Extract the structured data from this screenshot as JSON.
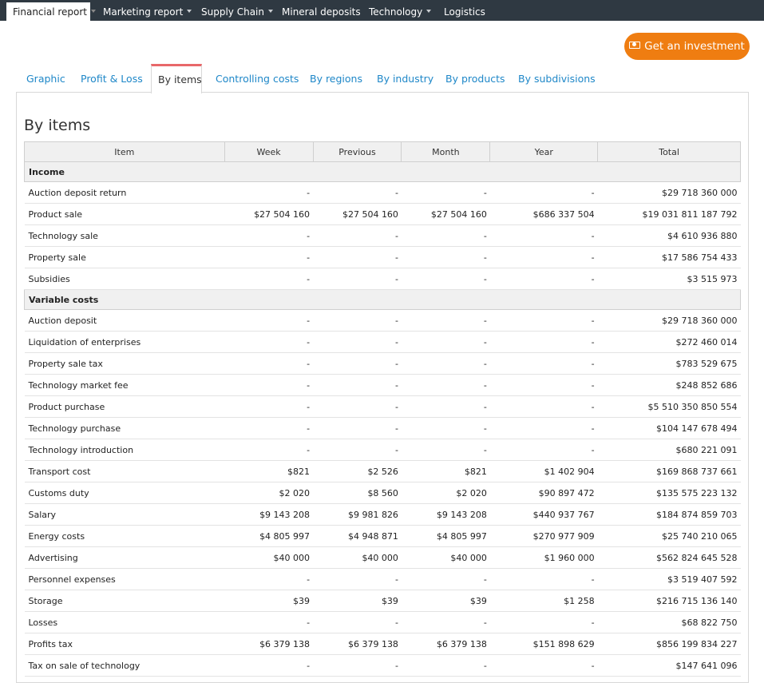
{
  "topnav": {
    "tabs": [
      {
        "label": "Financial report",
        "dropdown": true,
        "active": true
      },
      {
        "label": "Marketing report",
        "dropdown": true,
        "active": false
      },
      {
        "label": "Supply Chain",
        "dropdown": true,
        "active": false
      },
      {
        "label": "Mineral deposits",
        "dropdown": false,
        "active": false
      },
      {
        "label": "Technology",
        "dropdown": true,
        "active": false
      },
      {
        "label": "Logistics",
        "dropdown": false,
        "active": false
      }
    ]
  },
  "invest_button": {
    "label": "Get an investment",
    "icon": "money-icon",
    "color": "#ef7d11"
  },
  "subtabs": [
    "Graphic",
    "Profit & Loss",
    "By items",
    "Controlling costs",
    "By regions",
    "By industry",
    "By products",
    "By subdivisions"
  ],
  "active_subtab": "By items",
  "page_title": "By items",
  "table": {
    "columns": [
      "Item",
      "Week",
      "Previous",
      "Month",
      "Year",
      "Total"
    ],
    "sections": [
      {
        "title": "Income",
        "rows": [
          [
            "Auction deposit return",
            "-",
            "-",
            "-",
            "-",
            "$29 718 360 000"
          ],
          [
            "Product sale",
            "$27 504 160",
            "$27 504 160",
            "$27 504 160",
            "$686 337 504",
            "$19 031 811 187 792"
          ],
          [
            "Technology sale",
            "-",
            "-",
            "-",
            "-",
            "$4 610 936 880"
          ],
          [
            "Property sale",
            "-",
            "-",
            "-",
            "-",
            "$17 586 754 433"
          ],
          [
            "Subsidies",
            "-",
            "-",
            "-",
            "-",
            "$3 515 973"
          ]
        ]
      },
      {
        "title": "Variable costs",
        "rows": [
          [
            "Auction deposit",
            "-",
            "-",
            "-",
            "-",
            "$29 718 360 000"
          ],
          [
            "Liquidation of enterprises",
            "-",
            "-",
            "-",
            "-",
            "$272 460 014"
          ],
          [
            "Property sale tax",
            "-",
            "-",
            "-",
            "-",
            "$783 529 675"
          ],
          [
            "Technology market fee",
            "-",
            "-",
            "-",
            "-",
            "$248 852 686"
          ],
          [
            "Product purchase",
            "-",
            "-",
            "-",
            "-",
            "$5 510 350 850 554"
          ],
          [
            "Technology purchase",
            "-",
            "-",
            "-",
            "-",
            "$104 147 678 494"
          ],
          [
            "Technology introduction",
            "-",
            "-",
            "-",
            "-",
            "$680 221 091"
          ],
          [
            "Transport cost",
            "$821",
            "$2 526",
            "$821",
            "$1 402 904",
            "$169 868 737 661"
          ],
          [
            "Customs duty",
            "$2 020",
            "$8 560",
            "$2 020",
            "$90 897 472",
            "$135 575 223 132"
          ],
          [
            "Salary",
            "$9 143 208",
            "$9 981 826",
            "$9 143 208",
            "$440 937 767",
            "$184 874 859 703"
          ],
          [
            "Energy costs",
            "$4 805 997",
            "$4 948 871",
            "$4 805 997",
            "$270 977 909",
            "$25 740 210 065"
          ],
          [
            "Advertising",
            "$40 000",
            "$40 000",
            "$40 000",
            "$1 960 000",
            "$562 824 645 528"
          ],
          [
            "Personnel expenses",
            "-",
            "-",
            "-",
            "-",
            "$3 519 407 592"
          ],
          [
            "Storage",
            "$39",
            "$39",
            "$39",
            "$1 258",
            "$216 715 136 140"
          ],
          [
            "Losses",
            "-",
            "-",
            "-",
            "-",
            "$68 822 750"
          ],
          [
            "Profits tax",
            "$6 379 138",
            "$6 379 138",
            "$6 379 138",
            "$151 898 629",
            "$856 199 834 227"
          ],
          [
            "Tax on sale of technology",
            "-",
            "-",
            "-",
            "-",
            "$147 641 096"
          ]
        ]
      }
    ]
  }
}
